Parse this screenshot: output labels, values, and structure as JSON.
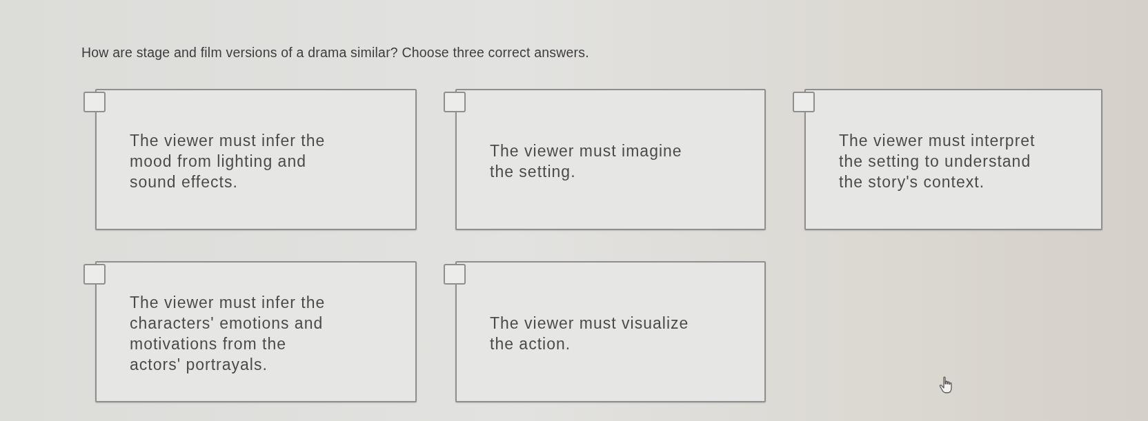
{
  "question": "How are stage and film versions of a drama similar? Choose three correct answers.",
  "options": [
    {
      "text": "The viewer must infer the mood from lighting and sound effects.",
      "checked": false
    },
    {
      "text": "The viewer must imagine the setting.",
      "checked": false
    },
    {
      "text": "The viewer must interpret the setting to understand the story's context.",
      "checked": false
    },
    {
      "text": "The viewer must infer the characters' emotions and motivations from the actors' portrayals.",
      "checked": false
    },
    {
      "text": "The viewer must visualize the action.",
      "checked": false
    }
  ]
}
